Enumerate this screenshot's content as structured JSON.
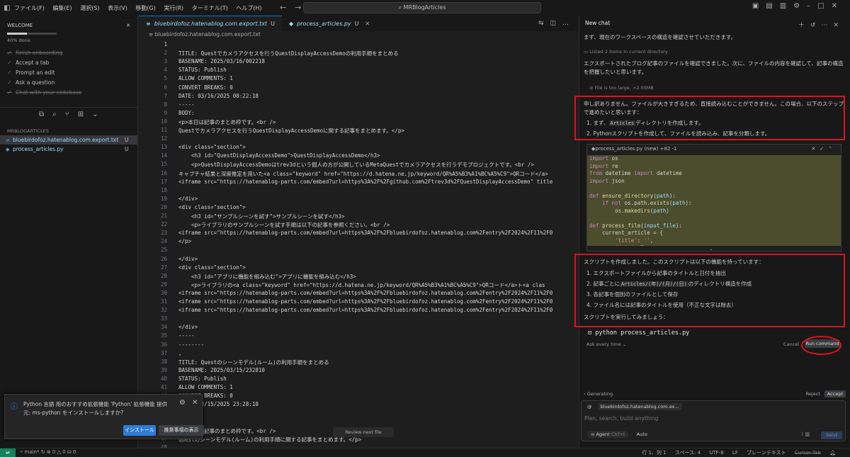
{
  "titlebar": {
    "menu": [
      "ファイル(F)",
      "編集(E)",
      "選択(S)",
      "表示(V)",
      "移動(G)",
      "実行(R)",
      "ターミナル(T)",
      "ヘルプ(H)"
    ],
    "search": "MRBlogArticles"
  },
  "welcome": {
    "title": "WELCOME",
    "progress_percent": 40,
    "progress_label": "40% done",
    "steps": [
      {
        "label": "Finish onboarding",
        "done": true
      },
      {
        "label": "Accept a tab",
        "done": false
      },
      {
        "label": "Prompt an edit",
        "done": false
      },
      {
        "label": "Ask a question",
        "done": false
      },
      {
        "label": "Chat with your codebase",
        "done": true
      }
    ]
  },
  "explorer": {
    "title": "MRBLOGARTICLES",
    "files": [
      {
        "name": "bluebirdofoz.hatenablog.com.export.txt",
        "status": "U"
      },
      {
        "name": "process_articles.py",
        "status": "U"
      }
    ]
  },
  "editor": {
    "tabs": [
      {
        "name": "bluebirdofoz.hatenablog.com.export.txt",
        "status": "U"
      },
      {
        "name": "process_articles.py",
        "status": "U"
      }
    ],
    "breadcrumb": "bluebirdofoz.hatenablog.com.export.txt",
    "lines": [
      "",
      "TITLE: Questでカメラアクセスを行うQuestDisplayAccessDemoの利用手順をまとめる",
      "BASENAME: 2025/03/16/002218",
      "STATUS: Publish",
      "ALLOW COMMENTS: 1",
      "CONVERT BREAKS: 0",
      "DATE: 03/16/2025 00:22:18",
      "-----",
      "BODY:",
      "<p>本日は記事のまとめ枠です。<br />",
      "Questでカメラアクセスを行うQuestDisplayAccessDemoに関する記事をまとめます。</p>",
      "",
      "<div class=\"section\">",
      "    <h3 id=\"QuestDisplayAccessDemo\">QuestDisplayAccessDemo</h3>",
      "    <p>QuestDisplayAccessDemoはtrev3dという個人の方が公開しているMetaQuestでカメラアクセスを行うデモプロジェクトです。<br />",
      "キャプチャ結果と深度推定を用いた<a class=\"keyword\" href=\"https://d.hatena.ne.jp/keyword/QR%A5%B3%A1%BC%A5%C9\">QRコード</a>",
      "<iframe src=\"https://hatenablog-parts.com/embed?url=https%3A%2F%2Fgithub.com%2Ftrev3d%2FQuestDisplayAccessDemo\" title",
      "",
      "</div>",
      "<div class=\"section\">",
      "    <h3 id=\"サンプルシーンを試す\">サンプルシーンを試す</h3>",
      "    <p>ライブラリのサンプルシーンを試す手順は以下の記事を参照ください。<br />",
      "<iframe src=\"https://hatenablog-parts.com/embed?url=https%3A%2F%2Fbluebirdofoz.hatenablog.com%2Fentry%2F2024%2F11%2F0",
      "</p>",
      "",
      "</div>",
      "<div class=\"section\">",
      "    <h3 id=\"アプリに機能を組み込む\">アプリに機能を組み込む</h3>",
      "    <p>ライブラリの<a class=\"keyword\" href=\"https://d.hatena.ne.jp/keyword/QR%A5%B3%A1%BC%A5%C9\">QRコード</a>ト<a clas",
      "<iframe src=\"https://hatenablog-parts.com/embed?url=https%3A%2F%2Fbluebirdofoz.hatenablog.com%2Fentry%2F2024%2F11%2F0",
      "<iframe src=\"https://hatenablog-parts.com/embed?url=https%3A%2F%2Fbluebirdofoz.hatenablog.com%2Fentry%2F2024%2F11%2F0",
      "<iframe src=\"https://hatenablog-parts.com/embed?url=https%3A%2F%2Fbluebirdofoz.hatenablog.com%2Fentry%2F2024%2F11%2F0",
      "",
      "</div>",
      "-----",
      "--------",
      ",",
      "TITLE: Questのシーンモデル(ルーム)の利用手順をまとめる",
      "BASENAME: 2025/03/15/232810",
      "STATUS: Publish",
      "ALLOW COMMENTS: 1",
      "CONVERT BREAKS: 0",
      "DATE: 03/15/2025 23:28:10",
      "-----",
      "BODY:",
      "<p>本日は記事のまとめ枠です。<br />",
      "Questのシーンモデル(ルーム)の利用手順に関する記事をまとめます。</p>",
      "",
      "<div class=\"section\">"
    ]
  },
  "notification": {
    "message": "Python 言語 用のおすすめ拡張機能 'Python' 拡張機能 提供元: ms-python をインストールしますか?",
    "install": "インストール",
    "show": "推奨事項の表示"
  },
  "review_button": "Review next file",
  "chat": {
    "title": "New chat",
    "msg1": "まず、現在のワークスペースの構造を確認させていただきます。",
    "tool1": "Listed 2 items in current directory",
    "msg2": "エクスポートされたブログ記事のファイルを確認できました。次に、ファイルの内容を確認して、記事の構造を把握したいと思います。",
    "error": "File is too large, >2.00MB",
    "msg3": "申し訳ありません。ファイルが大きすぎるため、直接読み込むことができません。この場合、以下のステップで進めたいと思います：",
    "step1_pre": "1. まず、",
    "step1_code": "Articles",
    "step1_post": "ディレクトリを作成します。",
    "step2": "2. Pythonスクリプトを作成して、ファイルを読み込み、記事を分類します。",
    "code_file": "process_articles.py",
    "code_tag": "(new)",
    "code_diff": "+82 -1",
    "msg4": "スクリプトを作成しました。このスクリプトは以下の機能を持っています：",
    "f1": "1. エクスポートファイルから記事のタイトルと日付を抽出",
    "f2_pre": "2. 記事ごとに",
    "f2_code": "Articles/(年)/(月)/(日)",
    "f2_post": "のディレクトリ構造を作成",
    "f3": "3. 各記事を個別のファイルとして保存",
    "f4": "4. ファイル名には記事のタイトルを使用（不正な文字は除去）",
    "msg5": "スクリプトを実行してみましょう：",
    "command": "python process_articles.py",
    "ask": "Ask every time",
    "cancel": "Cancel",
    "run": "Run command",
    "generating": "Generating.",
    "reject": "Reject",
    "accept": "Accept",
    "context_file": "bluebirdofoz.hatenablog.com.ex...",
    "placeholder": "Plan, search, build anything",
    "mode": "Agent",
    "mode_key": "Ctrl+I",
    "model": "Auto",
    "send": "Send"
  },
  "statusbar": {
    "branch": "main*",
    "errors": "0",
    "warnings": "0",
    "ports": "0",
    "position": "行 1、列 1",
    "spaces": "スペース: 4",
    "encoding": "UTF-8",
    "eol": "LF",
    "language": "プレーンテキスト",
    "cursor_tab": "Cursor Tab"
  }
}
